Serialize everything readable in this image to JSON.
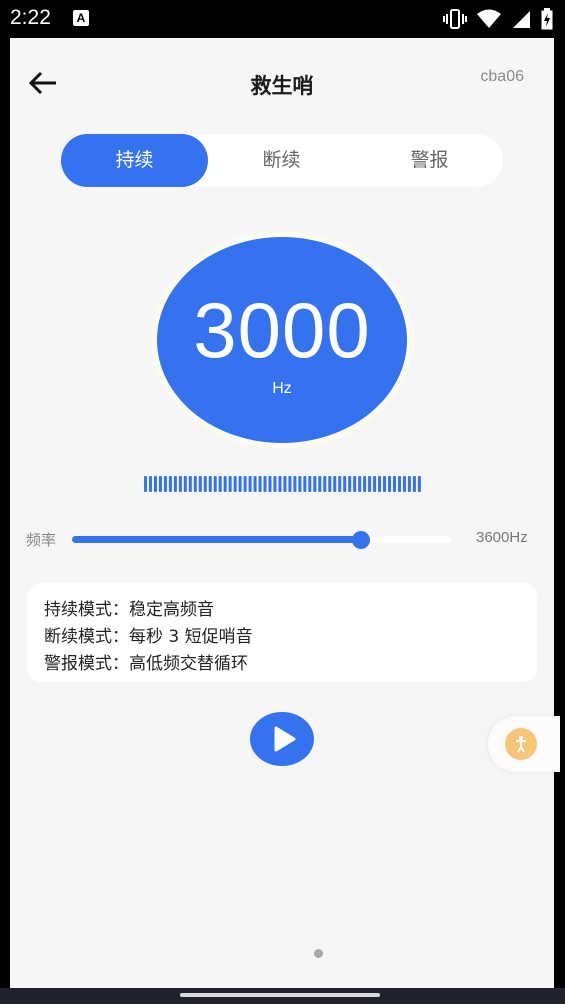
{
  "status_bar": {
    "time": "2:22",
    "notification_icon": "a-icon",
    "icons": [
      "vibrate-icon",
      "wifi-icon",
      "signal-icon",
      "battery-icon"
    ]
  },
  "header": {
    "title": "救生哨",
    "version": "cba06",
    "back_icon": "back-arrow-icon"
  },
  "tabs": [
    {
      "label": "持续",
      "active": true
    },
    {
      "label": "断续",
      "active": false
    },
    {
      "label": "警报",
      "active": false
    }
  ],
  "dial": {
    "frequency": "3000",
    "unit": "Hz"
  },
  "slider": {
    "label": "频率",
    "value_text": "3600Hz",
    "fill_fraction": 0.76
  },
  "info": {
    "lines": [
      "持续模式：稳定高频音",
      "断续模式：每秒 3 短促哨音",
      "警报模式：高低频交替循环"
    ]
  },
  "play_button": {
    "icon": "play-icon"
  },
  "floating_button": {
    "icon": "accessibility-icon"
  },
  "colors": {
    "accent": "#3472f0",
    "background": "#f6f6f6",
    "float_badge": "#f5c67a"
  }
}
